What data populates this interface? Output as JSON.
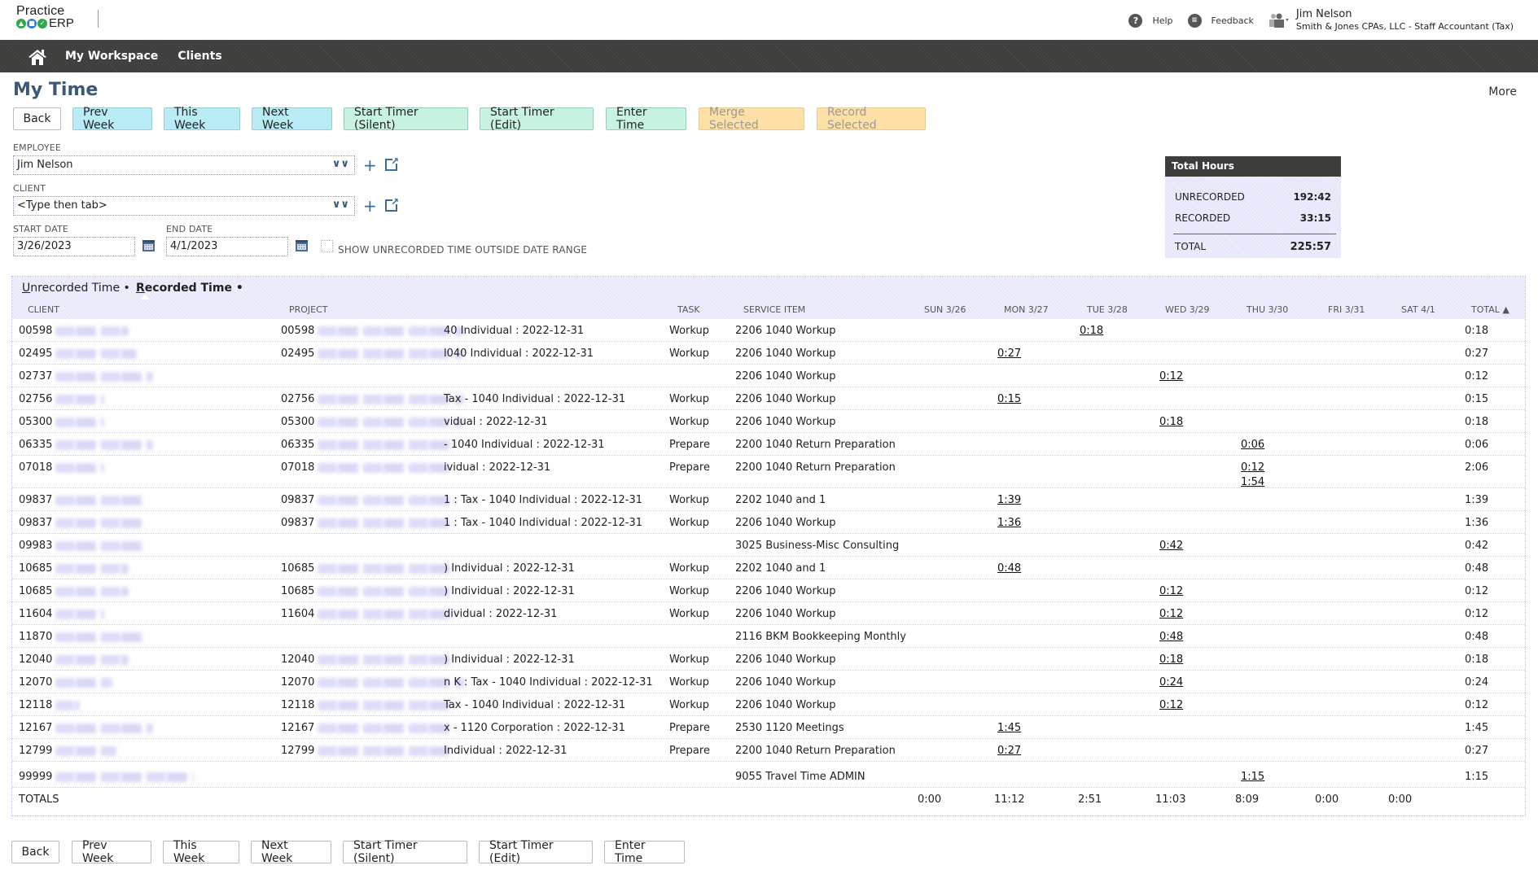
{
  "app": {
    "logo_top": "Practice",
    "logo_bottom": "ERP",
    "help_label": "Help",
    "feedback_label": "Feedback",
    "user_name": "Jim Nelson",
    "user_role": "Smith & Jones CPAs, LLC - Staff Accountant (Tax)"
  },
  "nav": {
    "items": [
      {
        "label": "My Workspace"
      },
      {
        "label": "Clients"
      }
    ]
  },
  "page": {
    "title": "My Time",
    "more_label": "More"
  },
  "toolbar_top": {
    "back": "Back",
    "prev_week": "Prev Week",
    "this_week": "This Week",
    "next_week": "Next Week",
    "start_timer_silent": "Start Timer (Silent)",
    "start_timer_edit": "Start Timer (Edit)",
    "enter_time": "Enter Time",
    "merge_selected": "Merge Selected",
    "record_selected": "Record Selected"
  },
  "toolbar_bottom": {
    "back": "Back",
    "prev_week": "Prev Week",
    "this_week": "This Week",
    "next_week": "Next Week",
    "start_timer_silent": "Start Timer (Silent)",
    "start_timer_edit": "Start Timer (Edit)",
    "enter_time": "Enter Time"
  },
  "form": {
    "employee_label": "EMPLOYEE",
    "employee_value": "Jim Nelson",
    "client_label": "CLIENT",
    "client_value": "<Type then tab>",
    "start_date_label": "START DATE",
    "start_date_value": "3/26/2023",
    "end_date_label": "END DATE",
    "end_date_value": "4/1/2023",
    "show_outside_label": "SHOW UNRECORDED TIME OUTSIDE DATE RANGE",
    "show_outside_checked": false
  },
  "total_hours": {
    "title": "Total Hours",
    "unrecorded_label": "UNRECORDED",
    "unrecorded_value": "192:42",
    "recorded_label": "RECORDED",
    "recorded_value": "33:15",
    "total_label": "TOTAL",
    "total_value": "225:57"
  },
  "tabs": {
    "unrecorded": "Unrecorded Time",
    "recorded": "Recorded Time",
    "active": "recorded"
  },
  "table": {
    "headers": {
      "client": "CLIENT",
      "project": "PROJECT",
      "task": "TASK",
      "service_item": "SERVICE ITEM",
      "sun": "SUN 3/26",
      "mon": "MON 3/27",
      "tue": "TUE 3/28",
      "wed": "WED 3/29",
      "thu": "THU 3/30",
      "fri": "FRI 3/31",
      "sat": "SAT 4/1",
      "total": "TOTAL ▲"
    },
    "day_keys": [
      "sun",
      "mon",
      "tue",
      "wed",
      "thu",
      "fri",
      "sat"
    ],
    "rows": [
      {
        "client_id": "00598",
        "project_id": "00598",
        "project_suffix": "40 Individual : 2022-12-31",
        "task": "Workup",
        "service_item": "2206 1040 Workup",
        "days": {
          "tue": [
            "0:18"
          ]
        },
        "total": "0:18"
      },
      {
        "client_id": "02495",
        "project_id": "02495",
        "project_suffix": "l040 Individual : 2022-12-31",
        "task": "Workup",
        "service_item": "2206 1040 Workup",
        "days": {
          "mon": [
            "0:27"
          ]
        },
        "total": "0:27"
      },
      {
        "client_id": "02737",
        "project_id": "",
        "project_suffix": "",
        "task": "",
        "service_item": "2206 1040 Workup",
        "days": {
          "wed": [
            "0:12"
          ]
        },
        "total": "0:12"
      },
      {
        "client_id": "02756",
        "project_id": "02756",
        "project_suffix": "Tax - 1040 Individual : 2022-12-31",
        "task": "Workup",
        "service_item": "2206 1040 Workup",
        "days": {
          "mon": [
            "0:15"
          ]
        },
        "total": "0:15"
      },
      {
        "client_id": "05300",
        "project_id": "05300",
        "project_suffix": "vidual : 2022-12-31",
        "task": "Workup",
        "service_item": "2206 1040 Workup",
        "days": {
          "wed": [
            "0:18"
          ]
        },
        "total": "0:18"
      },
      {
        "client_id": "06335",
        "project_id": "06335",
        "project_suffix": "- 1040 Individual : 2022-12-31",
        "task": "Prepare",
        "service_item": "2200 1040 Return Preparation",
        "days": {
          "thu": [
            "0:06"
          ]
        },
        "total": "0:06"
      },
      {
        "client_id": "07018",
        "project_id": "07018",
        "project_suffix": "ividual : 2022-12-31",
        "task": "Prepare",
        "service_item": "2200 1040 Return Preparation",
        "days": {
          "thu": [
            "0:12",
            "1:54"
          ]
        },
        "total": "2:06"
      },
      {
        "client_id": "09837",
        "project_id": "09837",
        "project_suffix": "1 : Tax - 1040 Individual : 2022-12-31",
        "task": "Workup",
        "service_item": "2202 1040 and 1",
        "days": {
          "mon": [
            "1:39"
          ]
        },
        "total": "1:39"
      },
      {
        "client_id": "09837",
        "project_id": "09837",
        "project_suffix": "1 : Tax - 1040 Individual : 2022-12-31",
        "task": "Workup",
        "service_item": "2206 1040 Workup",
        "days": {
          "mon": [
            "1:36"
          ]
        },
        "total": "1:36"
      },
      {
        "client_id": "09983",
        "project_id": "",
        "project_suffix": "",
        "task": "",
        "service_item": "3025 Business-Misc Consulting",
        "days": {
          "wed": [
            "0:42"
          ]
        },
        "total": "0:42"
      },
      {
        "client_id": "10685",
        "project_id": "10685",
        "project_suffix": ") Individual : 2022-12-31",
        "task": "Workup",
        "service_item": "2202 1040 and 1",
        "days": {
          "mon": [
            "0:48"
          ]
        },
        "total": "0:48"
      },
      {
        "client_id": "10685",
        "project_id": "10685",
        "project_suffix": ") Individual : 2022-12-31",
        "task": "Workup",
        "service_item": "2206 1040 Workup",
        "days": {
          "wed": [
            "0:12"
          ]
        },
        "total": "0:12"
      },
      {
        "client_id": "11604",
        "project_id": "11604",
        "project_suffix": "dividual : 2022-12-31",
        "task": "Workup",
        "service_item": "2206 1040 Workup",
        "days": {
          "wed": [
            "0:12"
          ]
        },
        "total": "0:12"
      },
      {
        "client_id": "11870",
        "project_id": "",
        "project_suffix": "",
        "task": "",
        "service_item": "2116 BKM Bookkeeping Monthly",
        "days": {
          "wed": [
            "0:48"
          ]
        },
        "total": "0:48"
      },
      {
        "client_id": "12040",
        "project_id": "12040",
        "project_suffix": ") Individual : 2022-12-31",
        "task": "Workup",
        "service_item": "2206 1040 Workup",
        "days": {
          "wed": [
            "0:18"
          ]
        },
        "total": "0:18"
      },
      {
        "client_id": "12070",
        "project_id": "12070",
        "project_suffix": "n K : Tax - 1040 Individual : 2022-12-31",
        "task": "Workup",
        "service_item": "2206 1040 Workup",
        "days": {
          "wed": [
            "0:24"
          ]
        },
        "total": "0:24"
      },
      {
        "client_id": "12118",
        "project_id": "12118",
        "project_suffix": "Tax - 1040 Individual : 2022-12-31",
        "task": "Workup",
        "service_item": "2206 1040 Workup",
        "days": {
          "wed": [
            "0:12"
          ]
        },
        "total": "0:12"
      },
      {
        "client_id": "12167",
        "project_id": "12167",
        "project_suffix": "x - 1120 Corporation : 2022-12-31",
        "task": "Prepare",
        "service_item": "2530 1120 Meetings",
        "days": {
          "mon": [
            "1:45"
          ]
        },
        "total": "1:45"
      },
      {
        "client_id": "12799",
        "project_id": "12799",
        "project_suffix": "Individual : 2022-12-31",
        "task": "Prepare",
        "service_item": "2200 1040 Return Preparation",
        "days": {
          "mon": [
            "0:27"
          ]
        },
        "total": "0:27"
      },
      {
        "client_id": "99999",
        "project_id": "",
        "project_suffix": "",
        "task": "",
        "service_item": "9055 Travel Time ADMIN",
        "days": {
          "thu": [
            "1:15"
          ]
        },
        "total": "1:15"
      }
    ],
    "totals": {
      "label": "TOTALS",
      "sun": "0:00",
      "mon": "11:12",
      "tue": "2:51",
      "wed": "11:03",
      "thu": "8:09",
      "fri": "0:00",
      "sat": "0:00"
    }
  }
}
